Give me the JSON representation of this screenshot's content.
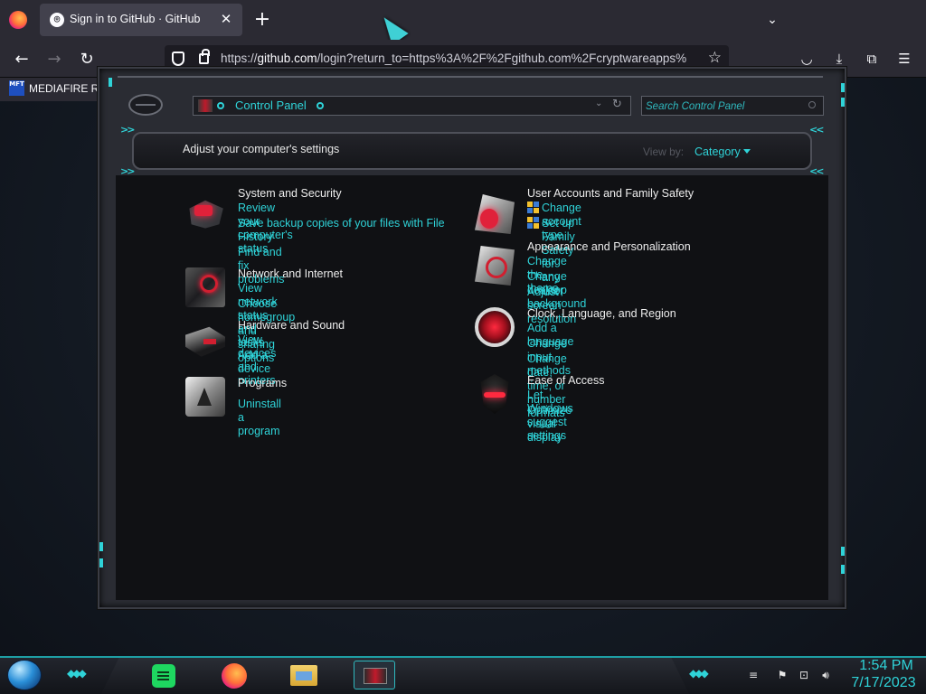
{
  "browser": {
    "tab_title": "Sign in to GitHub · GitHub",
    "tab_close": "✕",
    "new_tab": "+",
    "url_prefix": "https://",
    "url_host": "github.com",
    "url_rest": "/login?return_to=https%3A%2F%2Fgithub.com%2Fcryptwareapps%",
    "bookmark_label": "MEDIAFIRE RO",
    "bookmark_favicon": "MFT",
    "icons": {
      "back": "back-arrow-icon",
      "forward": "forward-arrow-icon",
      "reload": "reload-icon",
      "shield": "tracking-protection-icon",
      "lock": "lock-icon",
      "star": "bookmark-star-icon",
      "pocket": "pocket-icon",
      "downloads": "download-icon",
      "extensions": "extensions-icon",
      "menu": "hamburger-menu-icon"
    }
  },
  "control_panel": {
    "address": "Control Panel",
    "search_placeholder": "Search Control Panel",
    "header_title": "Adjust your computer's settings",
    "view_by_label": "View by:",
    "view_by_value": "Category",
    "left_column": [
      {
        "title": "System and Security",
        "icon": "system-security-icon",
        "links": [
          "Review your computer's status",
          "Save backup copies of your files with File History",
          "Find and fix problems"
        ]
      },
      {
        "title": "Network and Internet",
        "icon": "network-internet-icon",
        "links": [
          "View network status and tasks",
          "Choose homegroup and sharing options"
        ]
      },
      {
        "title": "Hardware and Sound",
        "icon": "hardware-sound-icon",
        "links": [
          "View devices and printers",
          "Add a device"
        ]
      },
      {
        "title": "Programs",
        "icon": "programs-icon",
        "links": [
          "Uninstall a program"
        ]
      }
    ],
    "right_column": [
      {
        "title": "User Accounts and Family Safety",
        "icon": "user-accounts-icon",
        "links": [
          "Change account type",
          "Set up Family Safety for any user"
        ]
      },
      {
        "title": "Appearance and Personalization",
        "icon": "appearance-icon",
        "links": [
          "Change the theme",
          "Change desktop background",
          "Adjust screen resolution"
        ]
      },
      {
        "title": "Clock, Language, and Region",
        "icon": "clock-region-icon",
        "links": [
          "Add a language",
          "Change input methods",
          "Change date, time, or number formats"
        ]
      },
      {
        "title": "Ease of Access",
        "icon": "ease-of-access-icon",
        "links": [
          "Let Windows suggest settings",
          "Optimize visual display"
        ]
      }
    ]
  },
  "taskbar": {
    "time": "1:54 PM",
    "date": "7/17/2023",
    "apps": [
      "spotify-icon",
      "firefox-icon",
      "file-explorer-icon",
      "control-panel-icon"
    ]
  },
  "colors": {
    "accent": "#2fd3d8",
    "link": "#2fd3d8",
    "alert_red": "#e0213a",
    "browser_chrome": "#2b2a33"
  }
}
